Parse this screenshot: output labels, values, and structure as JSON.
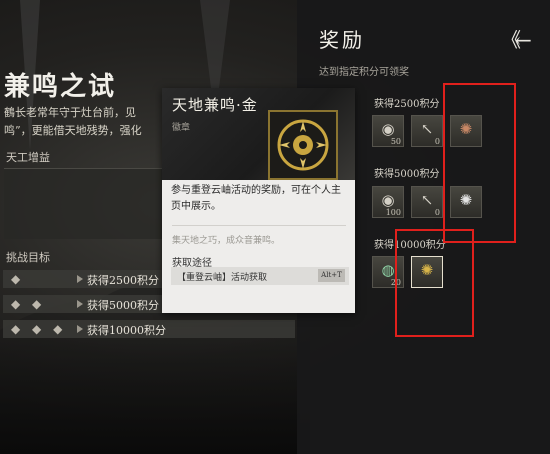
{
  "activity": {
    "title": "兼鸣之试",
    "desc_lines": [
      "鶴长老常年守于灶台前，见",
      "鸣”，更能借天地残势，强化"
    ],
    "gear_label": "天工增益",
    "challenge_label": "挑战目标",
    "challenges": [
      {
        "dots": "◆",
        "text": "获得2500积分"
      },
      {
        "dots": "◆ ◆",
        "text": "获得5000积分"
      },
      {
        "dots": "◆ ◆ ◆",
        "text": "获得10000积分"
      }
    ]
  },
  "rewards": {
    "title": "奖励",
    "back_icon": "《←",
    "subtitle": "达到指定积分可领奖",
    "tiers": [
      {
        "label": "获得2500积分",
        "items": [
          {
            "icon": "coin-icon",
            "glyph": "◉",
            "count": "50"
          },
          {
            "icon": "arrow-item-icon",
            "glyph": "↖",
            "count": "0"
          },
          {
            "icon": "bronze-badge-icon",
            "glyph": "✺",
            "count": ""
          }
        ]
      },
      {
        "label": "获得5000积分",
        "items": [
          {
            "icon": "coin-icon",
            "glyph": "◉",
            "count": "100"
          },
          {
            "icon": "arrow-item-icon",
            "glyph": "↖",
            "count": "0"
          },
          {
            "icon": "silver-badge-icon",
            "glyph": "✺",
            "count": ""
          }
        ]
      },
      {
        "label": "获得10000积分",
        "items": [
          {
            "icon": "jade-icon",
            "glyph": "◍",
            "count": "20"
          },
          {
            "icon": "gold-badge-icon",
            "glyph": "✺",
            "count": ""
          }
        ]
      }
    ]
  },
  "card": {
    "name": "天地兼鸣·金",
    "type": "徽章",
    "desc_lines": [
      "参与重登云岫活动的奖励，可在个人主",
      "页中展示。"
    ],
    "quote": "集天地之巧，成众音兼鸣。",
    "source_label": "获取途径",
    "source": "【重登云岫】活动获取",
    "key_hint": "Alt+T"
  },
  "colors": {
    "highlight": "#e0201c",
    "badge_gold": "#c9a640"
  }
}
